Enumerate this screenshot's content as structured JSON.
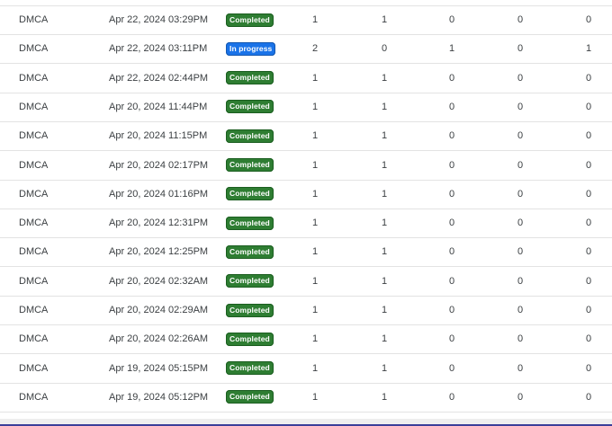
{
  "table": {
    "rows": [
      {
        "type": "DMCA",
        "date": "Apr 22, 2024 03:29PM",
        "status": "Completed",
        "status_kind": "completed",
        "n1": "1",
        "n2": "1",
        "n3": "0",
        "n4": "0",
        "n5": "0"
      },
      {
        "type": "DMCA",
        "date": "Apr 22, 2024 03:11PM",
        "status": "In progress",
        "status_kind": "progress",
        "n1": "2",
        "n2": "0",
        "n3": "1",
        "n4": "0",
        "n5": "1"
      },
      {
        "type": "DMCA",
        "date": "Apr 22, 2024 02:44PM",
        "status": "Completed",
        "status_kind": "completed",
        "n1": "1",
        "n2": "1",
        "n3": "0",
        "n4": "0",
        "n5": "0"
      },
      {
        "type": "DMCA",
        "date": "Apr 20, 2024 11:44PM",
        "status": "Completed",
        "status_kind": "completed",
        "n1": "1",
        "n2": "1",
        "n3": "0",
        "n4": "0",
        "n5": "0"
      },
      {
        "type": "DMCA",
        "date": "Apr 20, 2024 11:15PM",
        "status": "Completed",
        "status_kind": "completed",
        "n1": "1",
        "n2": "1",
        "n3": "0",
        "n4": "0",
        "n5": "0"
      },
      {
        "type": "DMCA",
        "date": "Apr 20, 2024 02:17PM",
        "status": "Completed",
        "status_kind": "completed",
        "n1": "1",
        "n2": "1",
        "n3": "0",
        "n4": "0",
        "n5": "0"
      },
      {
        "type": "DMCA",
        "date": "Apr 20, 2024 01:16PM",
        "status": "Completed",
        "status_kind": "completed",
        "n1": "1",
        "n2": "1",
        "n3": "0",
        "n4": "0",
        "n5": "0"
      },
      {
        "type": "DMCA",
        "date": "Apr 20, 2024 12:31PM",
        "status": "Completed",
        "status_kind": "completed",
        "n1": "1",
        "n2": "1",
        "n3": "0",
        "n4": "0",
        "n5": "0"
      },
      {
        "type": "DMCA",
        "date": "Apr 20, 2024 12:25PM",
        "status": "Completed",
        "status_kind": "completed",
        "n1": "1",
        "n2": "1",
        "n3": "0",
        "n4": "0",
        "n5": "0"
      },
      {
        "type": "DMCA",
        "date": "Apr 20, 2024 02:32AM",
        "status": "Completed",
        "status_kind": "completed",
        "n1": "1",
        "n2": "1",
        "n3": "0",
        "n4": "0",
        "n5": "0"
      },
      {
        "type": "DMCA",
        "date": "Apr 20, 2024 02:29AM",
        "status": "Completed",
        "status_kind": "completed",
        "n1": "1",
        "n2": "1",
        "n3": "0",
        "n4": "0",
        "n5": "0"
      },
      {
        "type": "DMCA",
        "date": "Apr 20, 2024 02:26AM",
        "status": "Completed",
        "status_kind": "completed",
        "n1": "1",
        "n2": "1",
        "n3": "0",
        "n4": "0",
        "n5": "0"
      },
      {
        "type": "DMCA",
        "date": "Apr 19, 2024 05:15PM",
        "status": "Completed",
        "status_kind": "completed",
        "n1": "1",
        "n2": "1",
        "n3": "0",
        "n4": "0",
        "n5": "0"
      },
      {
        "type": "DMCA",
        "date": "Apr 19, 2024 05:12PM",
        "status": "Completed",
        "status_kind": "completed",
        "n1": "1",
        "n2": "1",
        "n3": "0",
        "n4": "0",
        "n5": "0"
      }
    ]
  },
  "colors": {
    "completed_badge": "#2e7d32",
    "in_progress_badge": "#1a73e8",
    "row_divider": "#e3e3e3"
  }
}
